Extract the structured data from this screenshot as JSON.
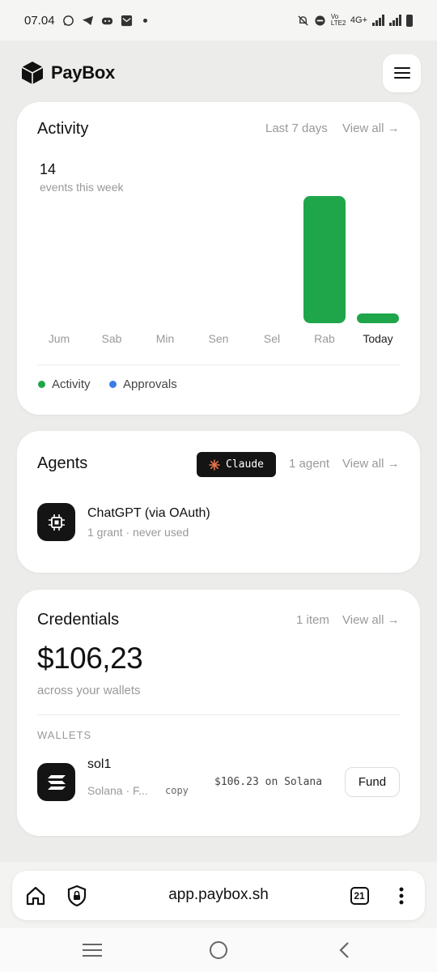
{
  "status_bar": {
    "time": "07.04",
    "network": "4G+",
    "volte": "Vo LTE2"
  },
  "header": {
    "brand": "PayBox"
  },
  "activity": {
    "title": "Activity",
    "range": "Last 7 days",
    "view_all": "View all →",
    "count": "14",
    "count_label": "events this week",
    "legend": [
      {
        "label": "Activity",
        "color": "#1fa64a"
      },
      {
        "label": "Approvals",
        "color": "#3b7be8"
      }
    ],
    "chart_data": {
      "type": "bar",
      "categories": [
        "Jum",
        "Sab",
        "Min",
        "Sen",
        "Sel",
        "Rab",
        "Today"
      ],
      "values": [
        0,
        0,
        0,
        0,
        0,
        13,
        1
      ],
      "series": [
        {
          "name": "Activity",
          "values": [
            0,
            0,
            0,
            0,
            0,
            13,
            1
          ]
        }
      ],
      "color": "#1fa64a"
    }
  },
  "agents": {
    "title": "Agents",
    "badge": "Claude",
    "count": "1 agent",
    "view_all": "View all →",
    "items": [
      {
        "name": "ChatGPT (via OAuth)",
        "sub": "1 grant · never used",
        "icon": "chip-icon"
      }
    ]
  },
  "credentials": {
    "title": "Credentials",
    "count": "1 item",
    "view_all": "View all →",
    "total": "$106,23",
    "total_label": "across your wallets",
    "section": "WALLETS",
    "wallets": [
      {
        "name": "sol1",
        "sub": "Solana · F...",
        "copy": "copy",
        "balance": "$106.23 on Solana",
        "action": "Fund",
        "icon": "solana-icon"
      }
    ]
  },
  "browser": {
    "url": "app.paybox.sh",
    "tabs": "21"
  }
}
